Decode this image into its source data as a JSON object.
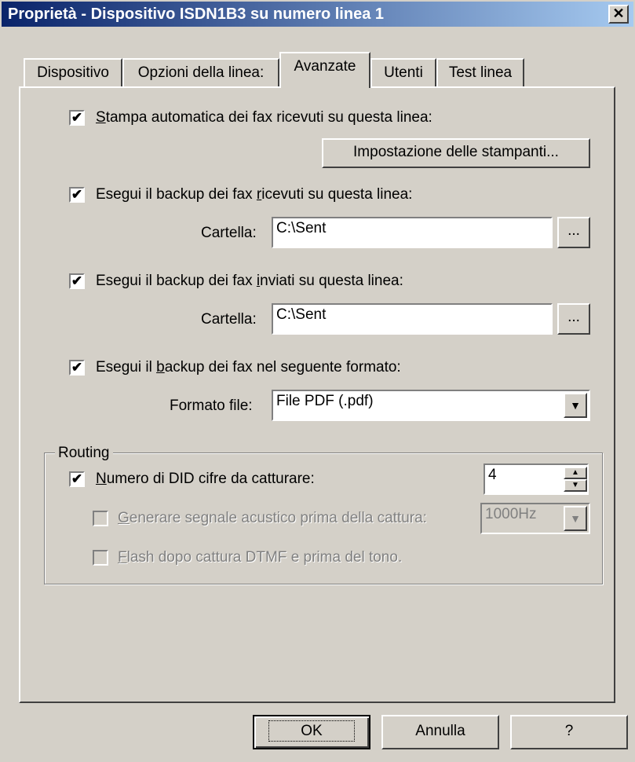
{
  "window": {
    "title": "Proprietà - Dispositivo ISDN1B3 su numero linea 1",
    "close_label": "✕"
  },
  "tabs": [
    {
      "label": "Dispositivo"
    },
    {
      "label": "Opzioni della linea:"
    },
    {
      "label": "Avanzate"
    },
    {
      "label": "Utenti"
    },
    {
      "label": "Test linea"
    }
  ],
  "print_section": {
    "checkbox_checked": "✔",
    "label_prefix": "",
    "label_mnemonic": "S",
    "label_rest": "tampa automatica dei fax ricevuti su questa linea:",
    "printer_setup_button": "Impostazione delle stampanti..."
  },
  "backup_received": {
    "checkbox_checked": "✔",
    "label_prefix": "Esegui il backup dei fax ",
    "label_mnemonic": "r",
    "label_rest": "icevuti su questa linea:",
    "folder_label": "Cartella:",
    "folder_value": "C:\\Sent",
    "browse_label": "..."
  },
  "backup_sent": {
    "checkbox_checked": "✔",
    "label_prefix": "Esegui il backup dei fax ",
    "label_mnemonic": "i",
    "label_rest": "nviati su questa linea:",
    "folder_label": "Cartella:",
    "folder_value": "C:\\Sent",
    "browse_label": "..."
  },
  "backup_format": {
    "checkbox_checked": "✔",
    "label_prefix": "Esegui il ",
    "label_mnemonic": "b",
    "label_rest": "ackup dei fax nel seguente formato:",
    "format_label": "Formato file:",
    "format_value": "File PDF (.pdf)",
    "dropdown_arrow": "▼"
  },
  "routing": {
    "legend": "Routing",
    "did_checked": "✔",
    "did_label_mnemonic": "N",
    "did_label_rest": "umero di DID cifre da catturare:",
    "did_value": "4",
    "spin_up": "▲",
    "spin_down": "▼",
    "beep_label_mnemonic": "G",
    "beep_label_rest": "enerare segnale acustico prima della cattura:",
    "beep_freq_value": "1000Hz",
    "beep_arrow": "▼",
    "flash_label_mnemonic": "F",
    "flash_label_rest": "lash dopo cattura DTMF e prima del tono."
  },
  "buttons": {
    "ok": "OK",
    "cancel": "Annulla",
    "help": "?"
  }
}
